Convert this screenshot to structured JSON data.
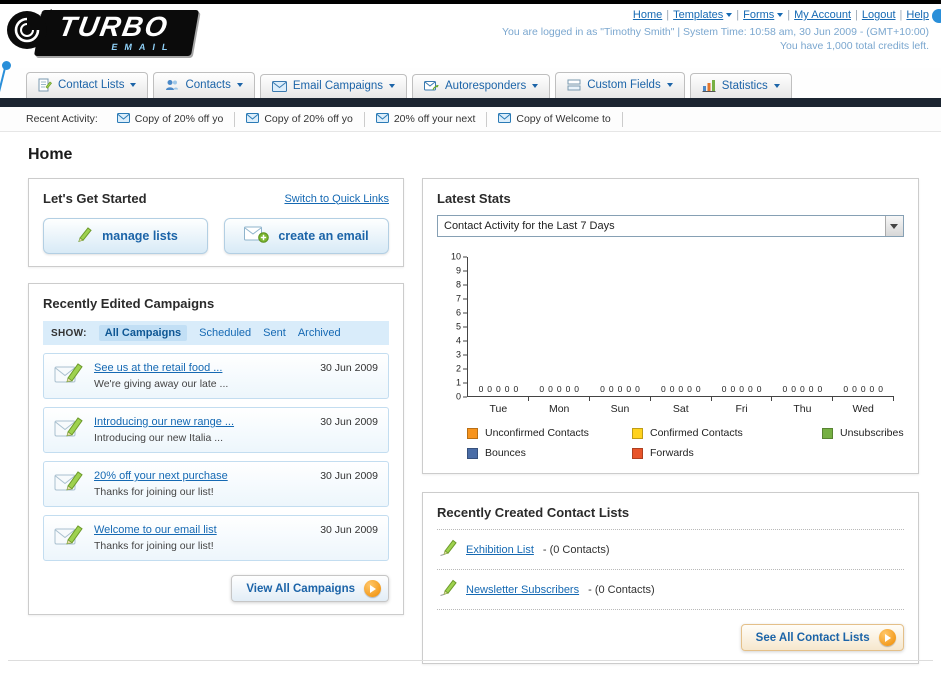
{
  "header": {
    "logo_title": "TURBO",
    "logo_subtitle": "EMAIL",
    "nav": [
      {
        "label": "Home",
        "dropdown": false
      },
      {
        "label": "Templates",
        "dropdown": true
      },
      {
        "label": "Forms",
        "dropdown": true
      },
      {
        "label": "My Account",
        "dropdown": false
      },
      {
        "label": "Logout",
        "dropdown": false
      },
      {
        "label": "Help",
        "dropdown": false
      }
    ],
    "login_info": "You are logged in as \"Timothy Smith\" | System Time: 10:58 am, 30 Jun 2009 - (GMT+10:00)",
    "credits": "You have 1,000 total credits left."
  },
  "tabs": [
    {
      "label": "Contact Lists"
    },
    {
      "label": "Contacts"
    },
    {
      "label": "Email Campaigns"
    },
    {
      "label": "Autoresponders"
    },
    {
      "label": "Custom Fields"
    },
    {
      "label": "Statistics"
    }
  ],
  "activity": {
    "label": "Recent Activity:",
    "items": [
      "Copy of 20% off yo",
      "Copy of 20% off yo",
      "20% off your next",
      "Copy of Welcome to"
    ]
  },
  "page_title": "Home",
  "get_started": {
    "title": "Let's Get Started",
    "switch_link": "Switch to Quick Links",
    "manage_button": "manage lists",
    "create_button": "create an email"
  },
  "campaigns": {
    "title": "Recently Edited Campaigns",
    "show_label": "SHOW:",
    "filters": [
      "All Campaigns",
      "Scheduled",
      "Sent",
      "Archived"
    ],
    "active_filter": "All Campaigns",
    "items": [
      {
        "title": "See us at the retail food ...",
        "subtitle": "We're giving away our late ...",
        "date": "30 Jun 2009"
      },
      {
        "title": "Introducing our new range ...",
        "subtitle": "Introducing our new Italia ...",
        "date": "30 Jun 2009"
      },
      {
        "title": "20% off your next purchase",
        "subtitle": "Thanks for joining our list!",
        "date": "30 Jun 2009"
      },
      {
        "title": "Welcome to our email list",
        "subtitle": "Thanks for joining our list!",
        "date": "30 Jun 2009"
      }
    ],
    "view_all_label": "View All Campaigns"
  },
  "stats": {
    "title": "Latest Stats",
    "period_value": "Contact Activity for the Last 7 Days",
    "chart_data": {
      "type": "bar",
      "title": "Contact Activity for the Last 7 Days",
      "categories": [
        "Tue",
        "Mon",
        "Sun",
        "Sat",
        "Fri",
        "Thu",
        "Wed"
      ],
      "series": [
        {
          "name": "Unconfirmed Contacts",
          "color": "#f7941d",
          "values": [
            0,
            0,
            0,
            0,
            0,
            0,
            0
          ]
        },
        {
          "name": "Confirmed Contacts",
          "color": "#ffd21e",
          "values": [
            0,
            0,
            0,
            0,
            0,
            0,
            0
          ]
        },
        {
          "name": "Unsubscribes",
          "color": "#76b043",
          "values": [
            0,
            0,
            0,
            0,
            0,
            0,
            0
          ]
        },
        {
          "name": "Bounces",
          "color": "#4a6da7",
          "values": [
            0,
            0,
            0,
            0,
            0,
            0,
            0
          ]
        },
        {
          "name": "Forwards",
          "color": "#e8542a",
          "values": [
            0,
            0,
            0,
            0,
            0,
            0,
            0
          ]
        }
      ],
      "xlabel": "",
      "ylabel": "",
      "ylim": [
        0,
        10
      ],
      "grid": false,
      "legend_position": "bottom"
    }
  },
  "contact_lists": {
    "title": "Recently Created Contact Lists",
    "items": [
      {
        "name": "Exhibition List",
        "meta": "- (0 Contacts)"
      },
      {
        "name": "Newsletter Subscribers",
        "meta": "- (0 Contacts)"
      }
    ],
    "see_all_label": "See All Contact Lists"
  }
}
